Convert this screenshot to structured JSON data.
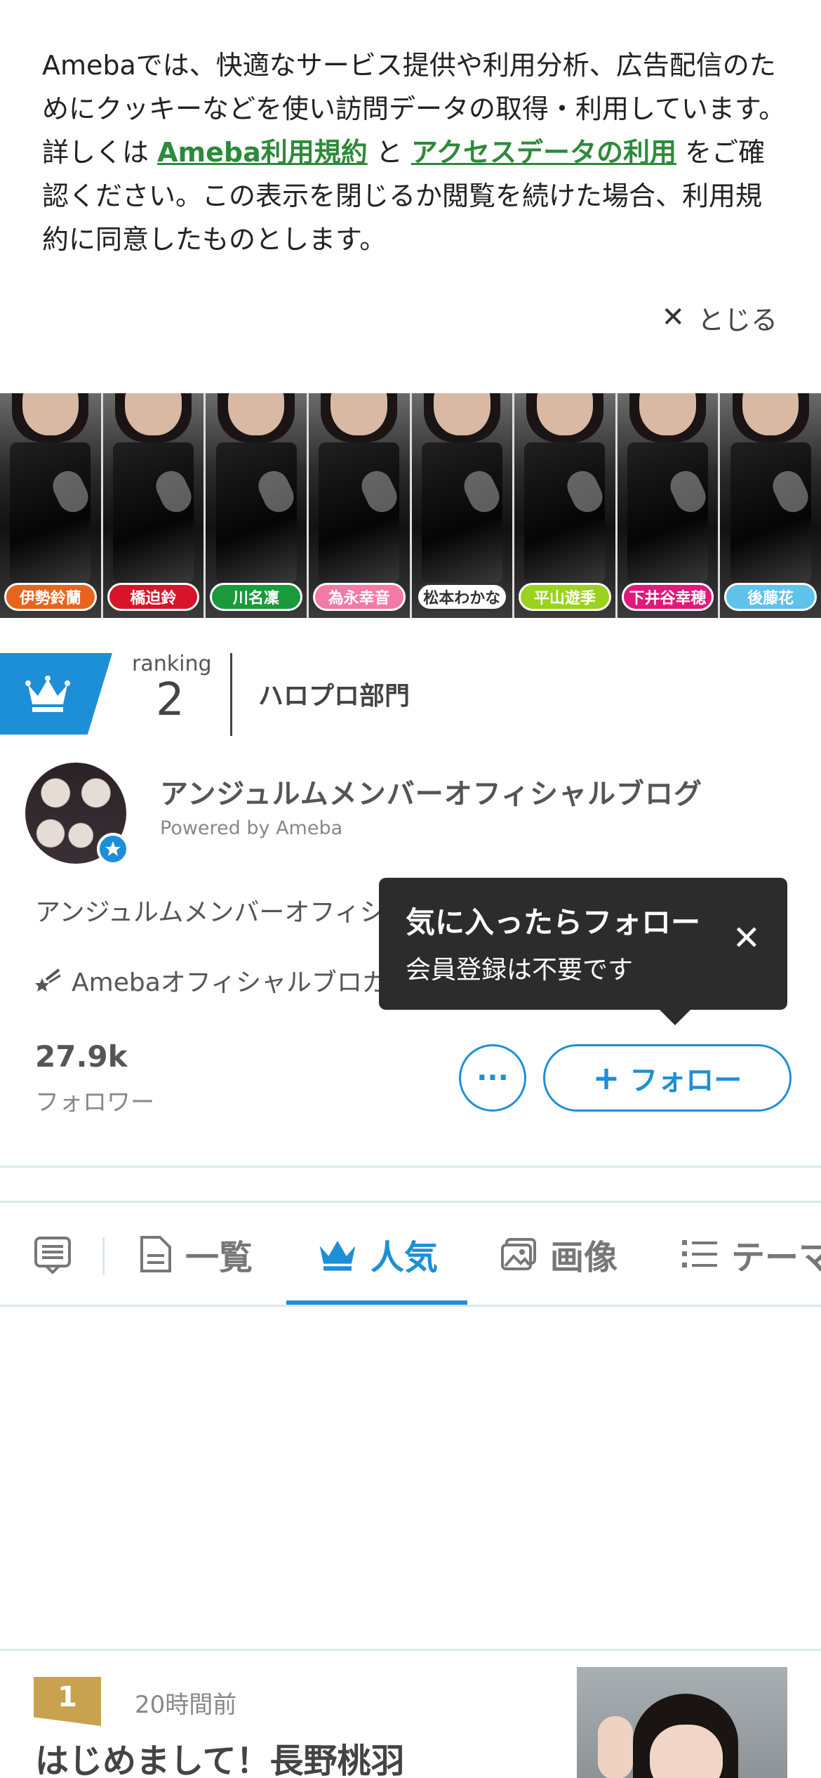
{
  "cookie_notice": {
    "text_before": "Amebaでは、快適なサービス提供や利用分析、広告配信のためにクッキーなどを使い訪問データの取得・利用しています。詳しくは ",
    "link_terms": "Ameba利用規約",
    "text_and": " と ",
    "link_access": "アクセスデータの利用",
    "text_after": " をご確認ください。この表示を閉じるか閲覧を続けた場合、利用規約に同意したものとします。",
    "close_label": "とじる"
  },
  "banner": {
    "members": [
      {
        "name": "伊勢鈴蘭",
        "color": "#e8641c"
      },
      {
        "name": "橋迫鈴",
        "color": "#d8142a"
      },
      {
        "name": "川名凜",
        "color": "#1a9a3a"
      },
      {
        "name": "為永幸音",
        "color": "#f27aa6"
      },
      {
        "name": "松本わかな",
        "color": "#ffffff"
      },
      {
        "name": "平山遊季",
        "color": "#9ad21e"
      },
      {
        "name": "下井谷幸穂",
        "color": "#e0197a"
      },
      {
        "name": "後藤花",
        "color": "#5fc2ea"
      }
    ]
  },
  "ranking": {
    "label": "ranking",
    "number": "2",
    "department": "ハロプロ部門"
  },
  "blog": {
    "title": "アンジュルムメンバーオフィシャルブログ",
    "powered_by": "Powered by Ameba",
    "description": "アンジュルムメンバーオフィシ",
    "official_label": "Amebaオフィシャルブロガ"
  },
  "tooltip": {
    "title": "気に入ったらフォロー",
    "subtitle": "会員登録は不要です"
  },
  "follow": {
    "followers_count": "27.9k",
    "followers_label": "フォロワー",
    "more_label": "···",
    "follow_label": "フォロー"
  },
  "tabs": [
    {
      "label": "一覧",
      "icon": "document-icon",
      "active": false
    },
    {
      "label": "人気",
      "icon": "crown-icon",
      "active": true
    },
    {
      "label": "画像",
      "icon": "image-icon",
      "active": false
    },
    {
      "label": "テーマ",
      "icon": "list-icon",
      "active": false
    }
  ],
  "post": {
    "rank": "1",
    "time": "20時間前",
    "title": "はじめまして！長野桃羽"
  },
  "colors": {
    "accent_blue": "#1d8fd6",
    "link_green": "#2d8a3a",
    "rank_gold": "#c9a24f",
    "tooltip_bg": "#2c2c2c"
  }
}
